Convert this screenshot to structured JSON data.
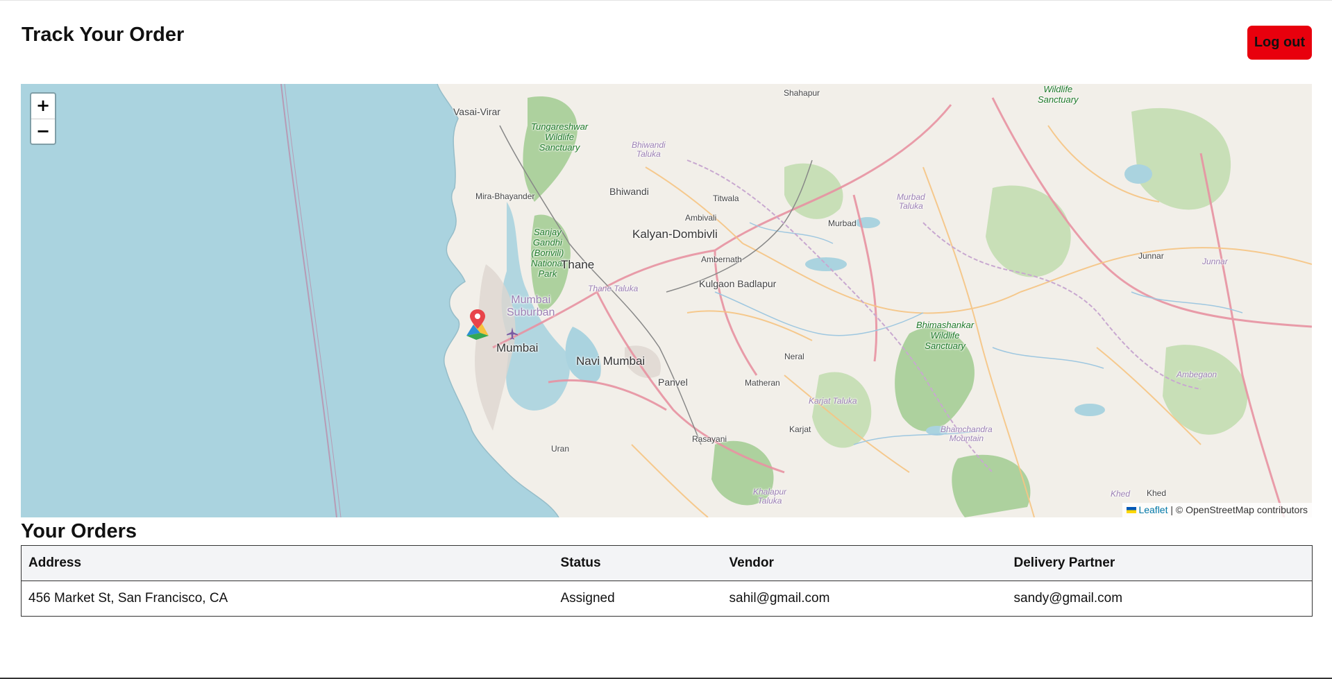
{
  "header": {
    "title": "Track Your Order",
    "logout_label": "Log out"
  },
  "map": {
    "zoom_in_label": "+",
    "zoom_out_label": "−",
    "attribution": {
      "leaflet_label": "Leaflet",
      "separator": " | © OpenStreetMap contributors"
    },
    "labels": {
      "vasai_virar": "Vasai-Virar",
      "tungareshwar_1": "Tungareshwar",
      "tungareshwar_2": "Wildlife",
      "tungareshwar_3": "Sanctuary",
      "bhiwandi_taluka_1": "Bhiwandi",
      "bhiwandi_taluka_2": "Taluka",
      "mira_bhayander": "Mira-Bhayander",
      "bhiwandi": "Bhiwandi",
      "titwala": "Titwala",
      "ambivali": "Ambivali",
      "kalyan_dombivli": "Kalyan-Dombivli",
      "shahapur": "Shahapur",
      "wildlife_top_1": "Wildlife",
      "wildlife_top_2": "Sanctuary",
      "murbad_taluka_1": "Murbad",
      "murbad_taluka_2": "Taluka",
      "murbad": "Murbad",
      "sanjay_1": "Sanjay",
      "sanjay_2": "Gandhi",
      "sanjay_3": "(Borivili)",
      "sanjay_4": "National",
      "sanjay_5": "Park",
      "thane": "Thane",
      "ambernath": "Ambernath",
      "kulgaon_badlapur": "Kulgaon Badlapur",
      "thane_taluka": "Thane Taluka",
      "mumbai_suburban_1": "Mumbai",
      "mumbai_suburban_2": "Suburban",
      "mumbai": "Mumbai",
      "navi_mumbai": "Navi Mumbai",
      "panvel": "Panvel",
      "neral": "Neral",
      "matheran": "Matheran",
      "karjat_taluka": "Karjat Taluka",
      "karjat": "Karjat",
      "rasayani": "Rasayani",
      "uran": "Uran",
      "khalapur_1": "Khalapur",
      "khalapur_2": "Taluka",
      "bhimashankar_1": "Bhimashankar",
      "bhimashankar_2": "Wildlife",
      "bhimashankar_3": "Sanctuary",
      "junnar": "Junnar",
      "junnar_taluka": "Junnar",
      "ambegaon": "Ambegaon",
      "bhamchandra_1": "Bhamchandra",
      "bhamchandra_2": "Mountain",
      "khed_taluka": "Khed",
      "khed": "Khed"
    },
    "colors": {
      "sea": "#aad3df",
      "land": "#f2efe9",
      "forest": "#add19e",
      "marker": "#e8444a"
    }
  },
  "orders": {
    "heading": "Your Orders",
    "columns": [
      "Address",
      "Status",
      "Vendor",
      "Delivery Partner"
    ],
    "rows": [
      {
        "address": "456 Market St, San Francisco, CA",
        "status": "Assigned",
        "vendor": "sahil@gmail.com",
        "delivery_partner": "sandy@gmail.com"
      }
    ]
  }
}
